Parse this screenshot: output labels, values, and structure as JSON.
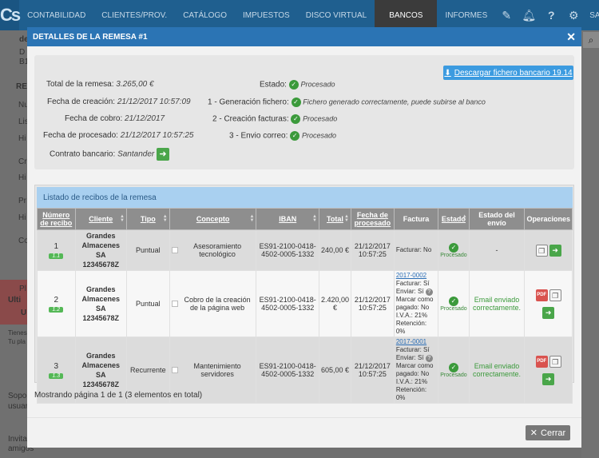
{
  "app": {
    "logo": "Cs",
    "nav": [
      "CONTABILIDAD",
      "CLIENTES/PROV.",
      "CATÁLOGO",
      "IMPUESTOS",
      "DISCO VIRTUAL",
      "BANCOS",
      "INFORMES"
    ],
    "active_nav": "BANCOS",
    "salir": "SALIR",
    "icons": [
      "edit-icon",
      "bell-icon",
      "help-icon",
      "gear-icon"
    ]
  },
  "background": {
    "texts": [
      "de",
      "D",
      "B1",
      "RE",
      "Nu",
      "Lis",
      "Hi",
      "Cr",
      "Hi",
      "Pr",
      "Hi",
      "Co",
      "Pl",
      "Ulti",
      "U",
      "Tienes",
      "Tu pla",
      "Sopo",
      "usuar",
      "Invita",
      "amigos"
    ]
  },
  "modal": {
    "title": "DETALLES DE LA REMESA #1",
    "close": "✕",
    "download_label": "Descargar fichero bancario 19.14",
    "summary": {
      "total_label": "Total de la remesa:",
      "total_value": "3.265,00 €",
      "creacion_label": "Fecha de creación:",
      "creacion_value": "21/12/2017 10:57:09",
      "cobro_label": "Fecha de cobro:",
      "cobro_value": "21/12/2017",
      "procesado_label": "Fecha de procesado:",
      "procesado_value": "21/12/2017 10:57:25",
      "contrato_label": "Contrato bancario:",
      "contrato_value": "Santander",
      "estado_label": "Estado:",
      "estado_value": "Procesado",
      "paso1_label": "1 - Generación fichero:",
      "paso1_value": "Fichero generado correctamente, puede subirse al banco",
      "paso2_label": "2 - Creación facturas:",
      "paso2_value": "Procesado",
      "paso3_label": "3 - Envio correo:",
      "paso3_value": "Procesado"
    },
    "list": {
      "title": "Listado de recibos de la remesa",
      "columns": [
        "Número de recibo",
        "Cliente",
        "Tipo",
        "Concepto",
        "IBAN",
        "Total",
        "Fecha de procesado",
        "Factura",
        "Estado",
        "Estado del envío",
        "Operaciones"
      ],
      "rows": [
        {
          "num": "1",
          "badge": "1.1",
          "cliente": "Grandes Almacenes SA 12345678Z",
          "tipo": "Puntual",
          "concepto": "Asesoramiento tecnológico",
          "iban": "ES91-2100-0418-4502-0005-1332",
          "total": "240,00 €",
          "fecha": "21/12/2017 10:57:25",
          "factura_link": "",
          "factura": [
            "Facturar: No"
          ],
          "estado": "Procesado",
          "envio": "-"
        },
        {
          "num": "2",
          "badge": "1.2",
          "cliente": "Grandes Almacenes SA 12345678Z",
          "tipo": "Puntual",
          "concepto": "Cobro de la creación de la página web",
          "iban": "ES91-2100-0418-4502-0005-1332",
          "total": "2.420,00 €",
          "fecha": "21/12/2017 10:57:25",
          "factura_link": "2017-0002",
          "factura": [
            "Facturar: Sí",
            "Enviar: Sí",
            "Marcar como pagado: No",
            "I.V.A.: 21%",
            "Retención: 0%"
          ],
          "estado": "Procesado",
          "envio": "Email enviado correctamente."
        },
        {
          "num": "3",
          "badge": "1.3",
          "cliente": "Grandes Almacenes SA 12345678Z",
          "tipo": "Recurrente",
          "concepto": "Mantenimiento servidores",
          "iban": "ES91-2100-0418-4502-0005-1332",
          "total": "605,00 €",
          "fecha": "21/12/2017 10:57:25",
          "factura_link": "2017-0001",
          "factura": [
            "Facturar: Sí",
            "Enviar: Sí",
            "Marcar como pagado: No",
            "I.V.A.: 21%",
            "Retención: 0%"
          ],
          "estado": "Procesado",
          "envio": "Email enviado correctamente."
        }
      ]
    },
    "paging": "Mostrando página 1 de 1 (3 elementos en total)",
    "cerrar": "Cerrar"
  }
}
